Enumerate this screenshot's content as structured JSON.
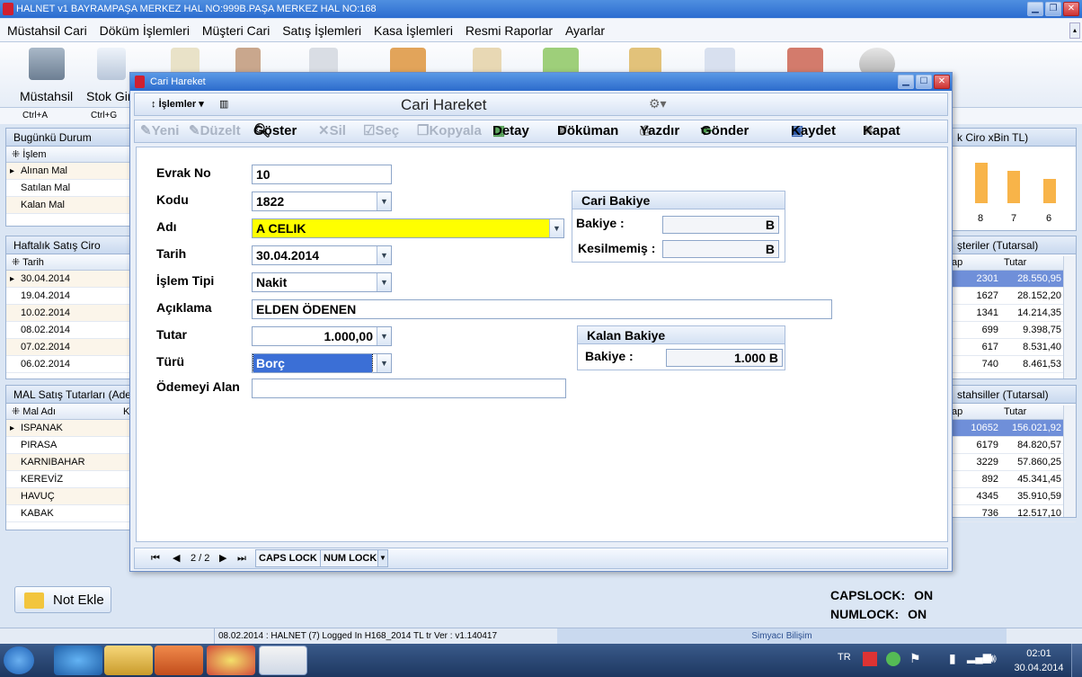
{
  "window": {
    "title": "HALNET v1 BAYRAMPAŞA MERKEZ HAL NO:999B.PAŞA MERKEZ HAL NO:168"
  },
  "menu": [
    "Müstahsil Cari",
    "Döküm İşlemleri",
    "Müşteri Cari",
    "Satış İşlemleri",
    "Kasa İşlemleri",
    "Resmi Raporlar",
    "Ayarlar"
  ],
  "ribbon": {
    "items": [
      {
        "label": "Müstahsil",
        "shortcut": "Ctrl+A"
      },
      {
        "label": "Stok Gir",
        "shortcut": "Ctrl+G"
      }
    ]
  },
  "left": {
    "today": {
      "title": "Bugünkü Durum",
      "col": "İşlem",
      "rows": [
        "Alınan Mal",
        "Satılan Mal",
        "Kalan Mal"
      ]
    },
    "weekly": {
      "title": "Haftalık Satış Ciro",
      "col": "Tarih",
      "rows": [
        "30.04.2014",
        "19.04.2014",
        "10.02.2014",
        "08.02.2014",
        "07.02.2014",
        "06.02.2014"
      ]
    },
    "mal": {
      "title": "MAL Satış Tutarları (Adet",
      "col": "Mal Adı",
      "col2": "K",
      "rows": [
        "ISPANAK",
        "PIRASA",
        "KARNIBAHAR",
        "KEREVİZ",
        "HAVUÇ",
        "KABAK"
      ]
    }
  },
  "right": {
    "chart": {
      "title": "k Ciro xBin TL)",
      "labels": [
        "8",
        "7",
        "6"
      ]
    },
    "customers": {
      "title": "şteriler (Tutarsal)",
      "col1": "ap",
      "col2": "Tutar",
      "rows": [
        [
          "2301",
          "28.550,95"
        ],
        [
          "1627",
          "28.152,20"
        ],
        [
          "1341",
          "14.214,35"
        ],
        [
          "699",
          "9.398,75"
        ],
        [
          "617",
          "8.531,40"
        ],
        [
          "740",
          "8.461,53"
        ]
      ]
    },
    "producers": {
      "title": "stahsiller (Tutarsal)",
      "col1": "ap",
      "col2": "Tutar",
      "rows": [
        [
          "10652",
          "156.021,92"
        ],
        [
          "6179",
          "84.820,57"
        ],
        [
          "3229",
          "57.860,25"
        ],
        [
          "892",
          "45.341,45"
        ],
        [
          "4345",
          "35.910,59"
        ],
        [
          "736",
          "12.517,10"
        ]
      ]
    }
  },
  "dialog": {
    "title": "Cari Hareket",
    "menu_label": "İşlemler",
    "header": "Cari Hareket",
    "toolbar": {
      "yeni": "Yeni",
      "duzelt": "Düzelt",
      "goster": "Göster",
      "sil": "Sil",
      "sec": "Seç",
      "kopyala": "Kopyala",
      "detay": "Detay",
      "dokuman": "Döküman",
      "yazdir": "Yazdır",
      "gonder": "Gönder",
      "kaydet": "Kaydet",
      "kapat": "Kapat"
    },
    "form": {
      "evrak_no": {
        "label": "Evrak No",
        "value": "10"
      },
      "kodu": {
        "label": "Kodu",
        "value": "1822"
      },
      "adi": {
        "label": "Adı",
        "value": "A CELIK"
      },
      "tarih": {
        "label": "Tarih",
        "value": "30.04.2014"
      },
      "islem_tipi": {
        "label": "İşlem Tipi",
        "value": "Nakit"
      },
      "aciklama": {
        "label": "Açıklama",
        "value": "ELDEN ÖDENEN"
      },
      "tutar": {
        "label": "Tutar",
        "value": "1.000,00"
      },
      "turu": {
        "label": "Türü",
        "value": "Borç"
      },
      "odemeyi_alan": {
        "label": "Ödemeyi Alan",
        "value": ""
      }
    },
    "cari_bakiye": {
      "title": "Cari Bakiye",
      "bakiye_label": "Bakiye :",
      "bakiye_value": "B",
      "kesilmemis_label": "Kesilmemiş :",
      "kesilmemis_value": "B"
    },
    "kalan_bakiye": {
      "title": "Kalan Bakiye",
      "bakiye_label": "Bakiye :",
      "bakiye_value": "1.000 B"
    },
    "nav": {
      "page": "2 / 2",
      "caps": "CAPS LOCK",
      "num": "NUM LOCK"
    }
  },
  "bottom": {
    "not_ekle": "Not Ekle",
    "caps_label": "CAPSLOCK:",
    "caps_val": "ON",
    "num_label": "NUMLOCK:",
    "num_val": "ON"
  },
  "status": {
    "left": "08.02.2014 : HALNET (7) Logged In H168_2014 TL tr Ver : v1.140417",
    "right": "Simyacı Bilişim"
  },
  "taskbar": {
    "lang": "TR",
    "time": "02:01",
    "date": "30.04.2014"
  },
  "colors": {
    "highlight_yellow": "#ffff00",
    "select_blue": "#3b6fd6",
    "bar_orange": "#f8b449"
  }
}
